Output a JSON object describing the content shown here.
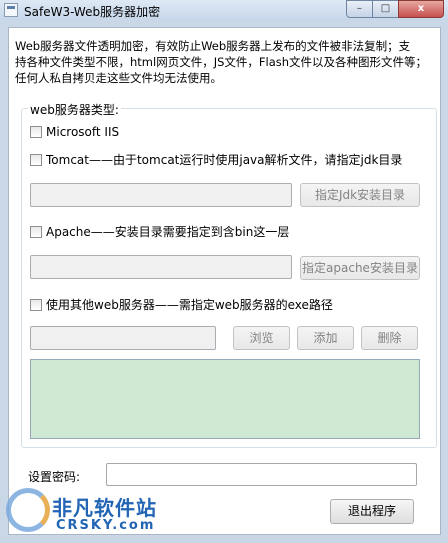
{
  "window": {
    "title": "SafeW3-Web服务器加密",
    "minimize_symbol": "–",
    "maximize_symbol": "□",
    "close_symbol": "x"
  },
  "description": {
    "line1": "Web服务器文件透明加密，有效防止Web服务器上发布的文件被非法复制；支",
    "line2": "持各种文件类型不限，html网页文件，JS文件，Flash文件以及各种图形文件等；",
    "line3": "任何人私自拷贝走这些文件均无法使用。"
  },
  "server_group": {
    "label": "web服务器类型:",
    "iis_label": "Microsoft IIS",
    "tomcat_label": "Tomcat——由于tomcat运行时使用java解析文件，请指定jdk目录",
    "jdk_button": "指定Jdk安装目录",
    "apache_label": "Apache——安装目录需要指定到含bin这一层",
    "apache_button": "指定apache安装目录",
    "other_label": "使用其他web服务器——需指定web服务器的exe路径",
    "browse_button": "浏览",
    "add_button": "添加",
    "delete_button": "删除"
  },
  "password": {
    "label": "设置密码:",
    "value": ""
  },
  "exit_button": "退出程序",
  "watermark": {
    "main": "非凡软件站",
    "sub": "CRSKY.com"
  },
  "colors": {
    "log_background": "#cfe8d2",
    "window_frame": "#c9d7e6"
  }
}
